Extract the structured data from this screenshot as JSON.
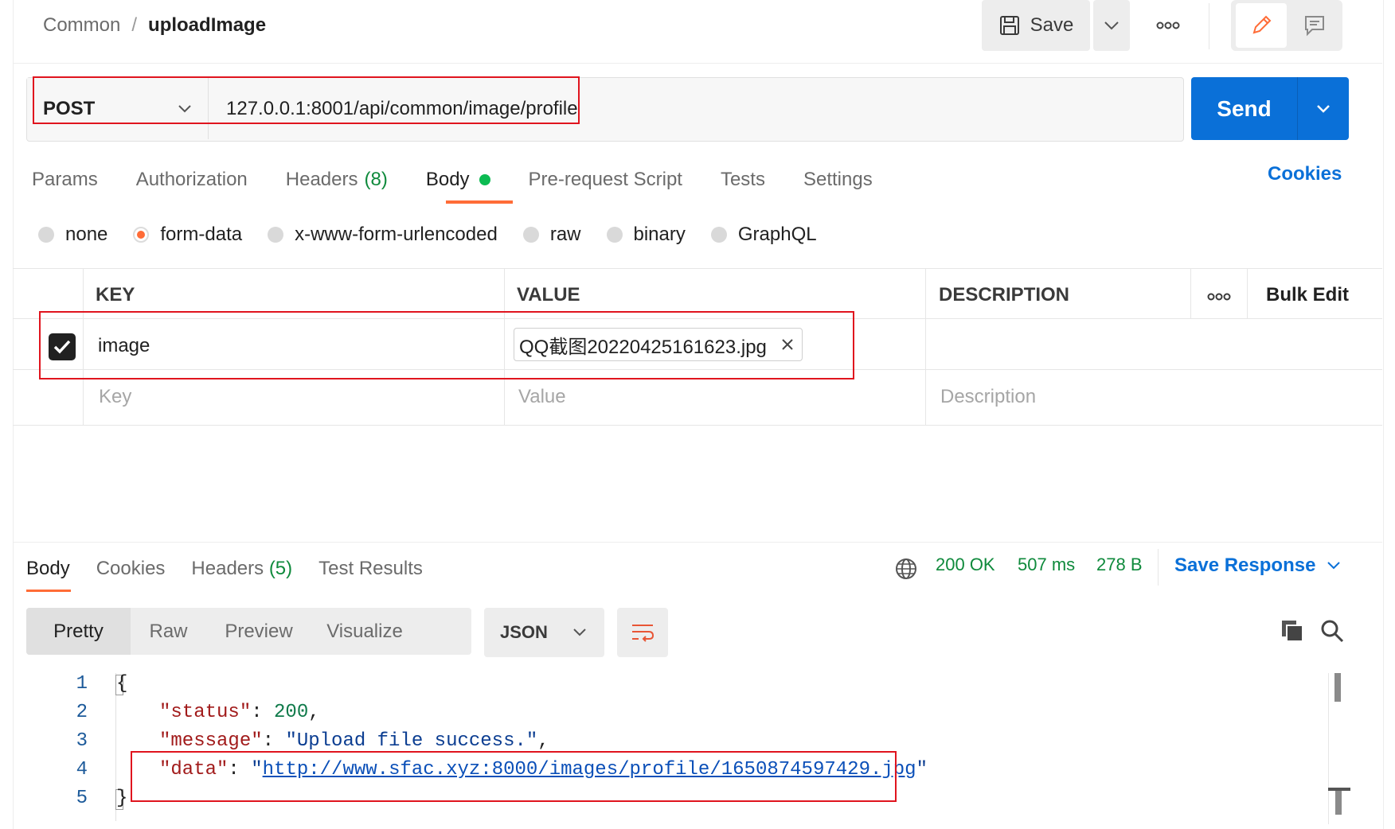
{
  "header": {
    "breadcrumb_parent": "Common",
    "breadcrumb_sep": "/",
    "breadcrumb_current": "uploadImage",
    "save_label": "Save",
    "more_icon": "ooo"
  },
  "request": {
    "method": "POST",
    "url": "127.0.0.1:8001/api/common/image/profile",
    "send_label": "Send"
  },
  "request_tabs": {
    "params": "Params",
    "authorization": "Authorization",
    "headers": "Headers",
    "headers_count": "(8)",
    "body": "Body",
    "prerequest": "Pre-request Script",
    "tests": "Tests",
    "settings": "Settings",
    "cookies": "Cookies"
  },
  "body_types": [
    "none",
    "form-data",
    "x-www-form-urlencoded",
    "raw",
    "binary",
    "GraphQL"
  ],
  "body_type_selected": "form-data",
  "params_table": {
    "col_key": "KEY",
    "col_value": "VALUE",
    "col_description": "DESCRIPTION",
    "more": "ooo",
    "bulk_edit": "Bulk Edit",
    "rows": [
      {
        "checked": true,
        "key": "image",
        "value_file": "QQ截图20220425161623.jpg",
        "description": ""
      }
    ],
    "placeholder_key": "Key",
    "placeholder_value": "Value",
    "placeholder_description": "Description"
  },
  "response": {
    "tabs": {
      "body": "Body",
      "cookies": "Cookies",
      "headers": "Headers",
      "headers_count": "(5)",
      "test_results": "Test Results"
    },
    "status": "200 OK",
    "time": "507 ms",
    "size": "278 B",
    "save_response": "Save Response",
    "views": [
      "Pretty",
      "Raw",
      "Preview",
      "Visualize"
    ],
    "view_selected": "Pretty",
    "format": "JSON",
    "code": {
      "line_numbers": [
        "1",
        "2",
        "3",
        "4",
        "5"
      ],
      "open_brace": "{",
      "close_brace": "}",
      "status_key": "\"status\"",
      "status_value": "200",
      "message_key": "\"message\"",
      "message_value": "\"Upload file success.\"",
      "data_key": "\"data\"",
      "data_value": "http://www.sfac.xyz:8000/images/profile/1650874597429.jpg"
    }
  },
  "colors": {
    "accent_orange": "#ff6c37",
    "send_blue": "#0a70d8",
    "status_green": "#0f8a3c",
    "annotation_red": "#e0141e"
  }
}
